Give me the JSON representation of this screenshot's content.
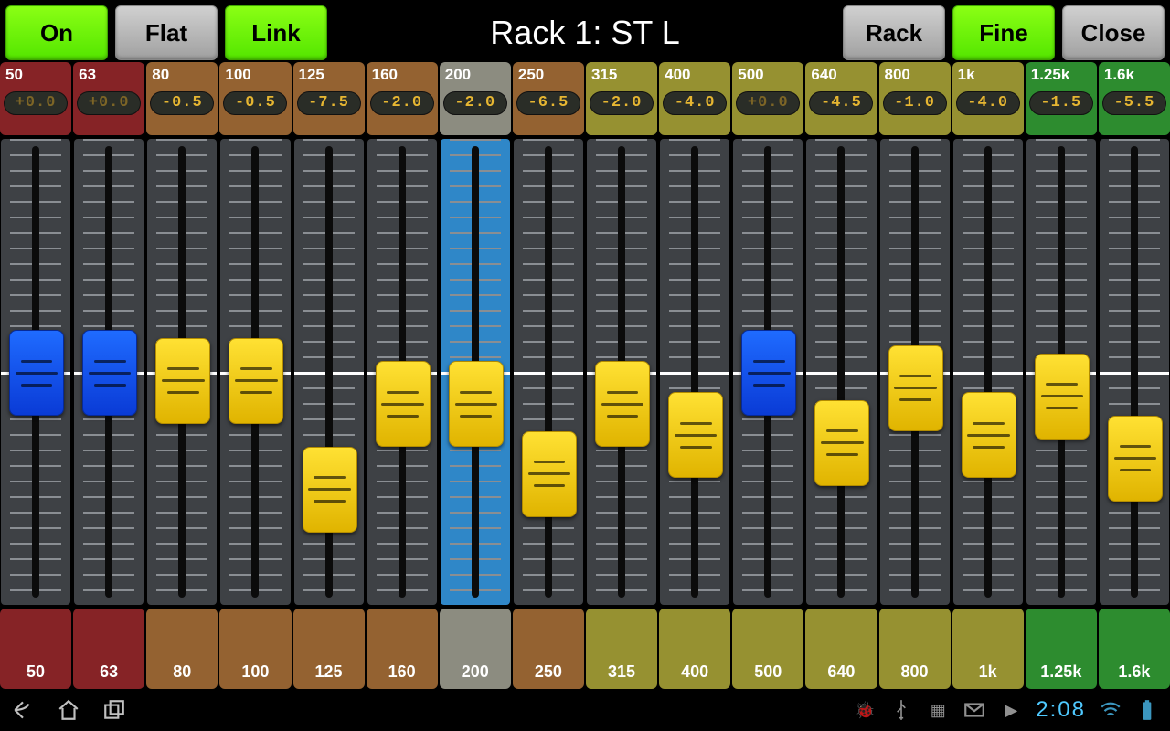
{
  "toolbar": {
    "on": "On",
    "flat": "Flat",
    "link": "Link",
    "title": "Rack 1: ST L",
    "rack": "Rack",
    "fine": "Fine",
    "close": "Close"
  },
  "fader": {
    "range": [
      -15,
      15
    ],
    "zero": 0
  },
  "bands": [
    {
      "freq": "50",
      "gain": "+0.0",
      "gain_val": 0.0,
      "color": "red",
      "knob": "blue",
      "selected": false,
      "dim": true
    },
    {
      "freq": "63",
      "gain": "+0.0",
      "gain_val": 0.0,
      "color": "red",
      "knob": "blue",
      "selected": false,
      "dim": true
    },
    {
      "freq": "80",
      "gain": "-0.5",
      "gain_val": -0.5,
      "color": "brown",
      "knob": "yellow",
      "selected": false,
      "dim": false
    },
    {
      "freq": "100",
      "gain": "-0.5",
      "gain_val": -0.5,
      "color": "brown",
      "knob": "yellow",
      "selected": false,
      "dim": false
    },
    {
      "freq": "125",
      "gain": "-7.5",
      "gain_val": -7.5,
      "color": "brown",
      "knob": "yellow",
      "selected": false,
      "dim": false
    },
    {
      "freq": "160",
      "gain": "-2.0",
      "gain_val": -2.0,
      "color": "brown",
      "knob": "yellow",
      "selected": false,
      "dim": false
    },
    {
      "freq": "200",
      "gain": "-2.0",
      "gain_val": -2.0,
      "color": "grey",
      "knob": "yellow",
      "selected": true,
      "dim": false
    },
    {
      "freq": "250",
      "gain": "-6.5",
      "gain_val": -6.5,
      "color": "brown",
      "knob": "yellow",
      "selected": false,
      "dim": false
    },
    {
      "freq": "315",
      "gain": "-2.0",
      "gain_val": -2.0,
      "color": "olive",
      "knob": "yellow",
      "selected": false,
      "dim": false
    },
    {
      "freq": "400",
      "gain": "-4.0",
      "gain_val": -4.0,
      "color": "olive",
      "knob": "yellow",
      "selected": false,
      "dim": false
    },
    {
      "freq": "500",
      "gain": "+0.0",
      "gain_val": 0.0,
      "color": "olive",
      "knob": "blue",
      "selected": false,
      "dim": true
    },
    {
      "freq": "640",
      "gain": "-4.5",
      "gain_val": -4.5,
      "color": "olive",
      "knob": "yellow",
      "selected": false,
      "dim": false
    },
    {
      "freq": "800",
      "gain": "-1.0",
      "gain_val": -1.0,
      "color": "olive",
      "knob": "yellow",
      "selected": false,
      "dim": false
    },
    {
      "freq": "1k",
      "gain": "-4.0",
      "gain_val": -4.0,
      "color": "olive",
      "knob": "yellow",
      "selected": false,
      "dim": false
    },
    {
      "freq": "1.25k",
      "gain": "-1.5",
      "gain_val": -1.5,
      "color": "green",
      "knob": "yellow",
      "selected": false,
      "dim": false
    },
    {
      "freq": "1.6k",
      "gain": "-5.5",
      "gain_val": -5.5,
      "color": "green",
      "knob": "yellow",
      "selected": false,
      "dim": false
    }
  ],
  "status": {
    "clock": "2:08"
  }
}
